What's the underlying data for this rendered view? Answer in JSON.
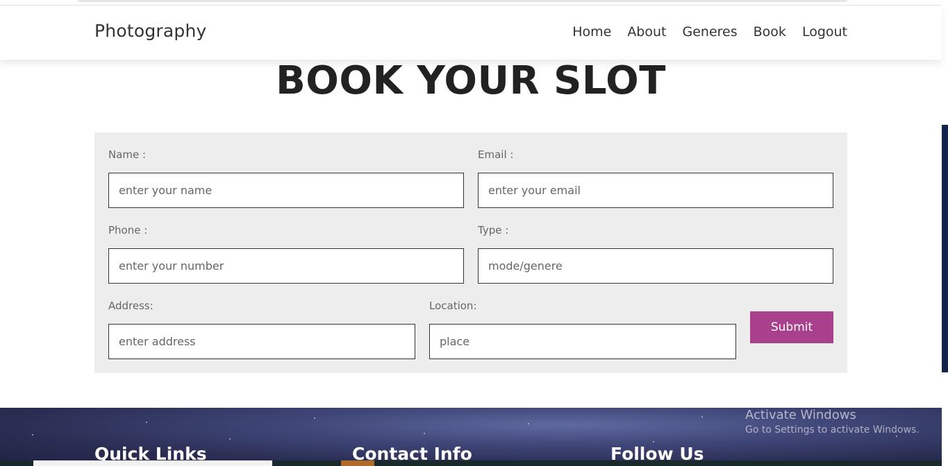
{
  "nav": {
    "brand": "Photography",
    "links": [
      "Home",
      "About",
      "Generes",
      "Book",
      "Logout"
    ]
  },
  "page": {
    "heading": "BOOK YOUR SLOT"
  },
  "form": {
    "name_label": "Name :",
    "name_placeholder": "enter your name",
    "email_label": "Email :",
    "email_placeholder": "enter your email",
    "phone_label": "Phone :",
    "phone_placeholder": "enter your number",
    "type_label": "Type :",
    "type_placeholder": "mode/genere",
    "address_label": "Address:",
    "address_placeholder": "enter address",
    "location_label": "Location:",
    "location_placeholder": "place",
    "submit_label": "Submit"
  },
  "footer": {
    "quick_links": "Quick Links",
    "contact_info": "Contact Info",
    "follow_us": "Follow Us"
  },
  "watermark": {
    "title": "Activate Windows",
    "subtitle": "Go to Settings to activate Windows."
  },
  "colors": {
    "accent": "#a8408c",
    "panel": "#ededed",
    "scroll_thumb": "#13234a"
  }
}
